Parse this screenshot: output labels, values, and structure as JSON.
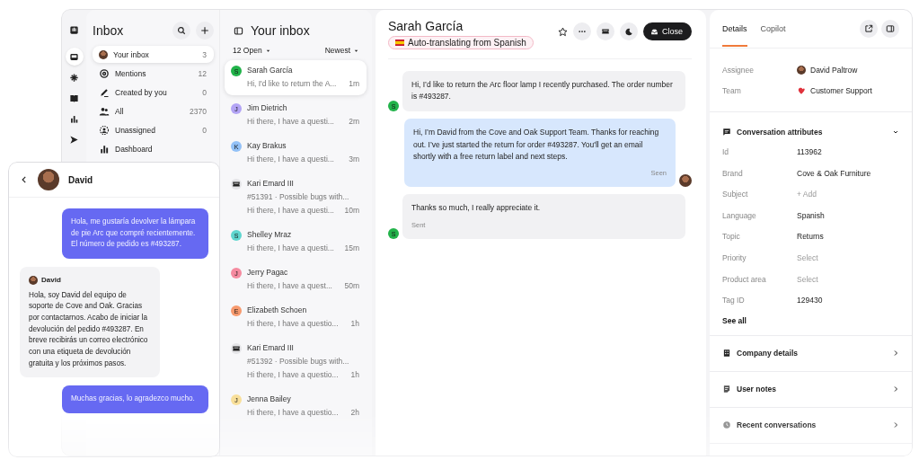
{
  "rail": [
    {
      "selected": false
    },
    {
      "selected": true
    },
    {
      "selected": false
    },
    {
      "selected": false
    },
    {
      "selected": false
    },
    {
      "selected": false
    }
  ],
  "nav": {
    "title": "Inbox",
    "items": [
      {
        "label": "Your inbox",
        "count": "3",
        "selected": true
      },
      {
        "label": "Mentions",
        "count": "12",
        "selected": false
      },
      {
        "label": "Created by you",
        "count": "0",
        "selected": false
      },
      {
        "label": "All",
        "count": "2370",
        "selected": false
      },
      {
        "label": "Unassigned",
        "count": "0",
        "selected": false
      },
      {
        "label": "Dashboard",
        "selected": false
      }
    ]
  },
  "list": {
    "title": "Your inbox",
    "filter": "12 Open",
    "sort": "Newest",
    "conversations": [
      {
        "kind": "person",
        "initial": "S",
        "color": "#22b34a",
        "name": "Sarah García",
        "preview": "Hi, I'd like to return the A...",
        "time": "1m",
        "selected": true
      },
      {
        "kind": "person",
        "initial": "J",
        "color": "#b3a4f5",
        "name": "Jim Dietrich",
        "preview": "Hi there, I have a questi...",
        "time": "2m",
        "selected": false
      },
      {
        "kind": "person",
        "initial": "K",
        "color": "#93c1f7",
        "name": "Kay Brakus",
        "preview": "Hi there, I have a questi...",
        "time": "3m",
        "selected": false
      },
      {
        "kind": "ticket",
        "name": "Kari Emard III",
        "subject": "#51391 · Possible bugs with...",
        "preview": "Hi there, I have a questi...",
        "time": "10m",
        "selected": false
      },
      {
        "kind": "person",
        "initial": "S",
        "color": "#5fd6cf",
        "name": "Shelley Mraz",
        "preview": "Hi there, I have a questi...",
        "time": "15m",
        "selected": false
      },
      {
        "kind": "person",
        "initial": "J",
        "color": "#f58ba0",
        "name": "Jerry Pagac",
        "preview": "Hi there, I have a quest...",
        "time": "50m",
        "selected": false
      },
      {
        "kind": "person",
        "initial": "E",
        "color": "#f79a6e",
        "name": "Elizabeth Schoen",
        "preview": "Hi there, I have a questio...",
        "time": "1h",
        "selected": false
      },
      {
        "kind": "ticket",
        "name": "Kari Emard III",
        "subject": "#51392 · Possible bugs with...",
        "preview": "Hi there, I have a questio...",
        "time": "1h",
        "selected": false
      },
      {
        "kind": "person",
        "initial": "J",
        "color": "#f8df9a",
        "name": "Jenna Bailey",
        "preview": "Hi there, I have a questio...",
        "time": "2h",
        "selected": false
      }
    ]
  },
  "chat": {
    "name": "Sarah García",
    "badge": "Auto-translating from Spanish",
    "close": "Close",
    "messages": [
      {
        "kind": "customer",
        "initial": "S",
        "text": "Hi, I’d like to return the Arc floor lamp I recently purchased. The order number is #493287."
      },
      {
        "kind": "agent",
        "text": "Hi, I’m David from the Cove and Oak Support Team. Thanks for reaching out. I’ve just started the return for order #493287. You'll get an email shortly with a free return label and next steps.",
        "status": "Seen"
      },
      {
        "kind": "customer",
        "initial": "S",
        "text": "Thanks so much, I really appreciate it.",
        "status": "Sent"
      }
    ]
  },
  "details": {
    "tabs": [
      {
        "label": "Details",
        "selected": true
      },
      {
        "label": "Copilot",
        "selected": false
      }
    ],
    "people": [
      {
        "label": "Assignee",
        "value": "David Paltrow"
      },
      {
        "label": "Team",
        "value": "Customer Support"
      }
    ],
    "attributes": {
      "title": "Conversation attributes",
      "expanded": true,
      "rows": [
        {
          "label": "Id",
          "value": "113962"
        },
        {
          "label": "Brand",
          "value": "Cove & Oak Furniture"
        },
        {
          "label": "Subject",
          "placeholder": "+ Add"
        },
        {
          "label": "Language",
          "value": "Spanish"
        },
        {
          "label": "Topic",
          "value": "Returns"
        },
        {
          "label": "Priority",
          "placeholder": "Select"
        },
        {
          "label": "Product area",
          "placeholder": "Select"
        },
        {
          "label": "Tag ID",
          "value": "129430"
        }
      ],
      "see_all": "See all"
    },
    "sections": [
      {
        "title": "Company details"
      },
      {
        "title": "User notes"
      },
      {
        "title": "Recent conversations"
      }
    ]
  },
  "mobile": {
    "name": "David",
    "messages": [
      {
        "kind": "user",
        "text": "Hola, me gustaría devolver la lámpara de pie Arc que compré recientemente. El número de pedido es #493287."
      },
      {
        "kind": "agent",
        "author": "David",
        "text": "Hola, soy David del equipo de soporte de Cove and Oak. Gracias por contactarnos. Acabo de iniciar la devolución del pedido #493287. En breve recibirás un correo electrónico con una etiqueta de devolución gratuita y los próximos pasos."
      },
      {
        "kind": "user",
        "text": "Muchas gracias, lo agradezco mucho."
      }
    ]
  }
}
